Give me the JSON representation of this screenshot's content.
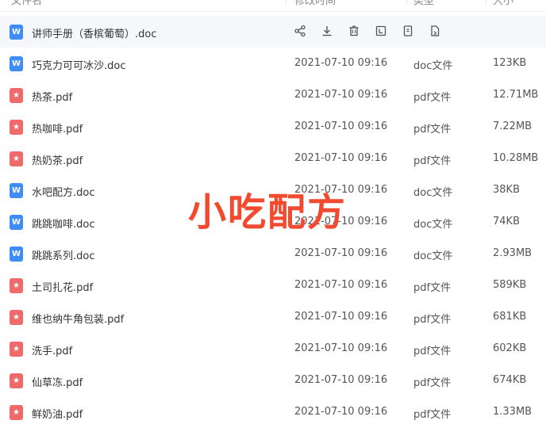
{
  "header": {
    "name_col": "文件名",
    "date_col": "修改时间",
    "type_col": "类型",
    "size_col": "大小"
  },
  "hover_row": {
    "name": "讲师手册（香槟葡萄）.doc",
    "icon": "word-file-icon"
  },
  "actions": [
    "share-icon",
    "download-icon",
    "delete-icon",
    "rename-icon",
    "copy-icon",
    "move-icon"
  ],
  "rows": [
    {
      "name": "巧克力可可冰沙.doc",
      "date": "2021-07-10 09:16",
      "type": "doc文件",
      "size": "123KB",
      "kind": "doc"
    },
    {
      "name": "热茶.pdf",
      "date": "2021-07-10 09:16",
      "type": "pdf文件",
      "size": "12.71MB",
      "kind": "pdf"
    },
    {
      "name": "热咖啡.pdf",
      "date": "2021-07-10 09:16",
      "type": "pdf文件",
      "size": "7.22MB",
      "kind": "pdf"
    },
    {
      "name": "热奶茶.pdf",
      "date": "2021-07-10 09:16",
      "type": "pdf文件",
      "size": "10.28MB",
      "kind": "pdf"
    },
    {
      "name": "水吧配方.doc",
      "date": "2021-07-10 09:16",
      "type": "doc文件",
      "size": "38KB",
      "kind": "doc"
    },
    {
      "name": "跳跳咖啡.doc",
      "date": "2021-07-10 09:16",
      "type": "doc文件",
      "size": "74KB",
      "kind": "doc"
    },
    {
      "name": "跳跳系列.doc",
      "date": "2021-07-10 09:16",
      "type": "doc文件",
      "size": "2.93MB",
      "kind": "doc"
    },
    {
      "name": "土司扎花.pdf",
      "date": "2021-07-10 09:16",
      "type": "pdf文件",
      "size": "589KB",
      "kind": "pdf"
    },
    {
      "name": "维也纳牛角包装.pdf",
      "date": "2021-07-10 09:16",
      "type": "pdf文件",
      "size": "681KB",
      "kind": "pdf"
    },
    {
      "name": "洗手.pdf",
      "date": "2021-07-10 09:16",
      "type": "pdf文件",
      "size": "602KB",
      "kind": "pdf"
    },
    {
      "name": "仙草冻.pdf",
      "date": "2021-07-10 09:16",
      "type": "pdf文件",
      "size": "674KB",
      "kind": "pdf"
    },
    {
      "name": "鲜奶油.pdf",
      "date": "2021-07-10 09:16",
      "type": "pdf文件",
      "size": "1.33MB",
      "kind": "pdf"
    }
  ],
  "overlay_text": "小吃配方",
  "colors": {
    "doc": "#3e8cf6",
    "pdf": "#f06a6a",
    "overlay": "#f24a2f",
    "accent": "#4a8cf7"
  }
}
